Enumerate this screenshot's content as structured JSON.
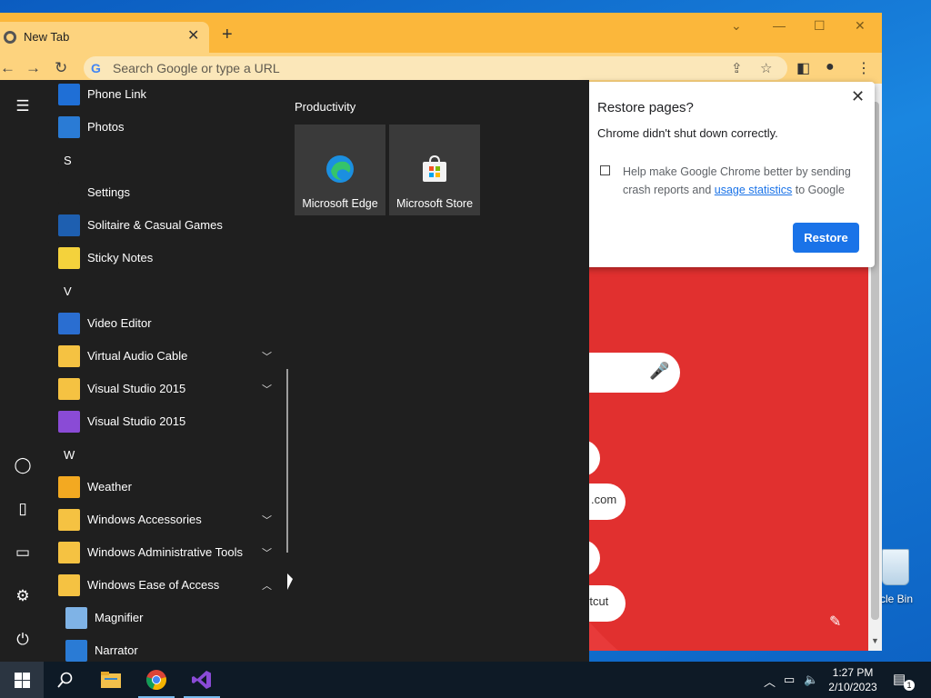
{
  "chrome": {
    "tab_title": "New Tab",
    "omnibox_placeholder": "Search Google or type a URL",
    "ntp_pills": [
      ".com",
      "rtcut"
    ],
    "restore_popup": {
      "title": "Restore pages?",
      "message": "Chrome didn't shut down correctly.",
      "help_text_before": "Help make Google Chrome better by sending crash reports and",
      "help_link": "usage statistics",
      "help_text_after": "to Google",
      "restore_button": "Restore"
    }
  },
  "start_menu": {
    "apps": [
      {
        "label": "Phone Link",
        "icon": "phone-link-icon",
        "color": "#1f6fd6"
      },
      {
        "label": "Photos",
        "icon": "photos-icon",
        "color": "#2a7bd5"
      },
      {
        "letter": "S"
      },
      {
        "label": "Settings",
        "icon": "gear-icon",
        "color": "#1f1f1f"
      },
      {
        "label": "Solitaire & Casual Games",
        "icon": "solitaire-icon",
        "color": "#1e5fb0"
      },
      {
        "label": "Sticky Notes",
        "icon": "sticky-notes-icon",
        "color": "#f4d23c"
      },
      {
        "letter": "V"
      },
      {
        "label": "Video Editor",
        "icon": "video-editor-icon",
        "color": "#2a6ed1"
      },
      {
        "label": "Virtual Audio Cable",
        "icon": "folder-icon",
        "color": "#f5c242",
        "expandable": true
      },
      {
        "label": "Visual Studio 2015",
        "icon": "folder-icon",
        "color": "#f5c242",
        "expandable": true
      },
      {
        "label": "Visual Studio 2015",
        "icon": "visual-studio-icon",
        "color": "#8a4bd6"
      },
      {
        "letter": "W"
      },
      {
        "label": "Weather",
        "icon": "weather-icon",
        "color": "#f3a921"
      },
      {
        "label": "Windows Accessories",
        "icon": "folder-icon",
        "color": "#f5c242",
        "expandable": true
      },
      {
        "label": "Windows Administrative Tools",
        "icon": "folder-icon",
        "color": "#f5c242",
        "expandable": true
      },
      {
        "label": "Windows Ease of Access",
        "icon": "folder-icon",
        "color": "#f5c242",
        "expanded": true
      },
      {
        "label": "Magnifier",
        "icon": "magnifier-icon",
        "color": "#7fb3e6",
        "sub": true
      },
      {
        "label": "Narrator",
        "icon": "narrator-icon",
        "color": "#2a7bd5",
        "sub": true
      }
    ],
    "tile_group": "Productivity",
    "tiles": [
      {
        "label": "Microsoft Edge",
        "icon": "edge-icon"
      },
      {
        "label": "Microsoft Store",
        "icon": "store-icon"
      }
    ]
  },
  "desktop": {
    "recycle_bin_label": "cle Bin"
  },
  "taskbar": {
    "apps": [
      "search-icon",
      "file-explorer-icon",
      "chrome-icon",
      "visual-studio-icon"
    ],
    "time": "1:27 PM",
    "date": "2/10/2023",
    "notification_count": "1"
  }
}
